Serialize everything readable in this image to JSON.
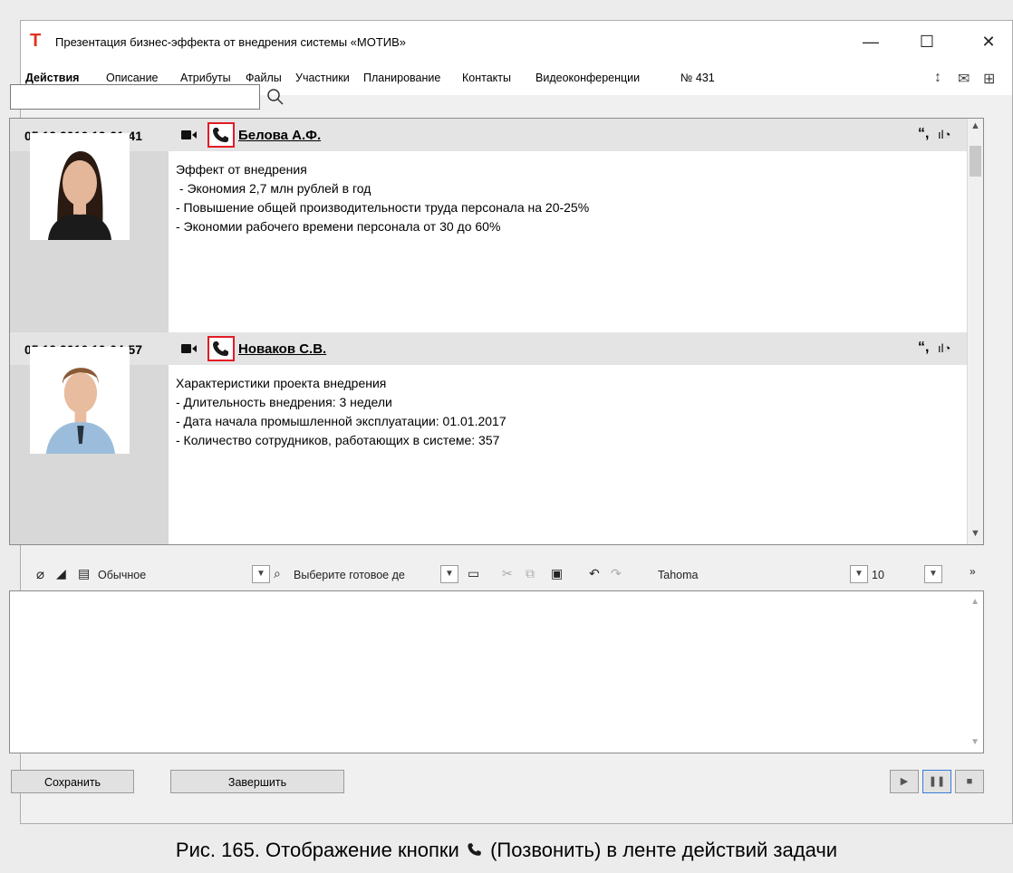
{
  "window": {
    "title": "Презентация бизнес-эффекта от внедрения системы «МОТИВ»",
    "logo_glyph": "Т",
    "min": "—",
    "max": "☐",
    "close": "✕"
  },
  "tabs": [
    "Действия",
    "Описание",
    "Атрибуты",
    "Файлы",
    "Участники",
    "Планирование",
    "Контакты",
    "Видеоконференции",
    "№ 431"
  ],
  "search": {
    "value": "",
    "placeholder": ""
  },
  "feed": [
    {
      "date": "05.12.2016 12:21:41",
      "author": "Белова А.Ф.",
      "text": "Эффект от внедрения\n - Экономия 2,7 млн рублей в год\n- Повышение общей производительности труда персонала на 20-25%\n- Экономии рабочего времени персонала от 30 до 60%"
    },
    {
      "date": "05.12.2016 10:04:57",
      "author": "Новаков С.В.",
      "text": "Характеристики проекта внедрения\n- Длительность внедрения: 3 недели\n- Дата начала промышленной эксплуатации: 01.01.2017\n- Количество сотрудников, работающих в системе: 357"
    }
  ],
  "editor_toolbar": {
    "style": "Обычное",
    "template": "Выберите готовое де",
    "font": "Tahoma",
    "size": "10"
  },
  "buttons": {
    "save": "Сохранить",
    "finish": "Завершить"
  },
  "caption": {
    "before": "Рис. 165. Отображение кнопки",
    "after": "(Позвонить) в ленте действий задачи"
  }
}
